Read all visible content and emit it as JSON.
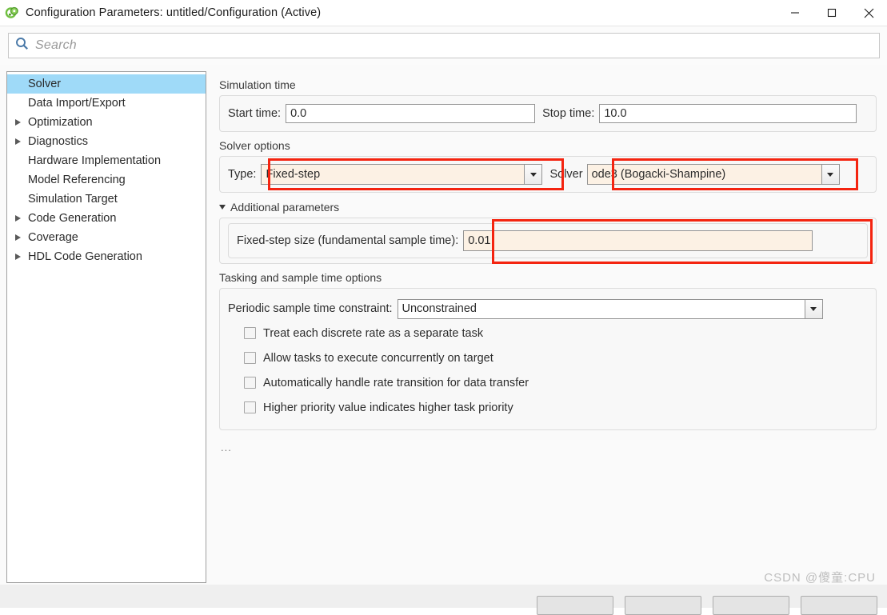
{
  "window": {
    "title": "Configuration Parameters: untitled/Configuration (Active)",
    "icon": "simulink-icon",
    "minimize_label": "—",
    "maximize_label": "□",
    "close_label": "✕"
  },
  "search": {
    "placeholder": "Search",
    "value": "",
    "icon": "search-icon"
  },
  "sidebar": {
    "items": [
      {
        "label": "Solver",
        "expandable": false,
        "selected": true
      },
      {
        "label": "Data Import/Export",
        "expandable": false,
        "selected": false
      },
      {
        "label": "Optimization",
        "expandable": true,
        "selected": false
      },
      {
        "label": "Diagnostics",
        "expandable": true,
        "selected": false
      },
      {
        "label": "Hardware Implementation",
        "expandable": false,
        "selected": false
      },
      {
        "label": "Model Referencing",
        "expandable": false,
        "selected": false
      },
      {
        "label": "Simulation Target",
        "expandable": false,
        "selected": false
      },
      {
        "label": "Code Generation",
        "expandable": true,
        "selected": false
      },
      {
        "label": "Coverage",
        "expandable": true,
        "selected": false
      },
      {
        "label": "HDL Code Generation",
        "expandable": true,
        "selected": false
      }
    ]
  },
  "main": {
    "simulation_time": {
      "group_title": "Simulation time",
      "start_label": "Start time:",
      "start_value": "0.0",
      "stop_label": "Stop time:",
      "stop_value": "10.0"
    },
    "solver_options": {
      "group_title": "Solver options",
      "type_label": "Type:",
      "type_value": "Fixed-step",
      "solver_label": "Solver",
      "solver_value": "ode3 (Bogacki-Shampine)"
    },
    "additional_parameters": {
      "disclosure_label": "Additional parameters",
      "expanded": true,
      "fixed_step_label": "Fixed-step size (fundamental sample time):",
      "fixed_step_value": "0.01"
    },
    "tasking": {
      "group_title": "Tasking and sample time options",
      "constraint_label": "Periodic sample time constraint:",
      "constraint_value": "Unconstrained",
      "checkboxes": [
        {
          "label": "Treat each discrete rate as a separate task",
          "checked": false
        },
        {
          "label": "Allow tasks to execute concurrently on target",
          "checked": false
        },
        {
          "label": "Automatically handle rate transition for data transfer",
          "checked": false
        },
        {
          "label": "Higher priority value indicates higher task priority",
          "checked": false
        }
      ]
    },
    "overflow_indicator": "..."
  },
  "footer": {
    "watermark": "CSDN @傻童:CPU",
    "buttons": [
      "",
      "",
      "",
      ""
    ]
  },
  "colors": {
    "selection": "#9fdaf8",
    "modified_field": "#fcf1e4",
    "annotation": "#f42410",
    "footer_bg": "#efefef"
  }
}
